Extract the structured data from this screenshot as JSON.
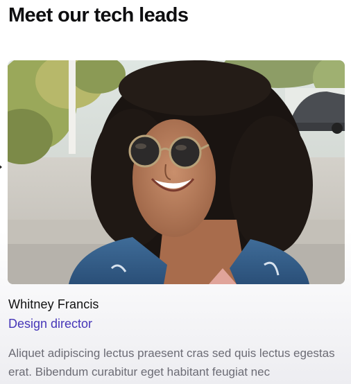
{
  "section": {
    "heading": "Meet our tech leads"
  },
  "lead": {
    "name": "Whitney Francis",
    "role": "Design director",
    "bio": "Aliquet adipiscing lectus praesent cras sed quis lectus egestas erat. Bibendum curabitur eget habitant feugiat nec",
    "photo_icon": "portrait-photo"
  },
  "colors": {
    "accent": "#4636b8",
    "body_text": "#6b6b74"
  }
}
